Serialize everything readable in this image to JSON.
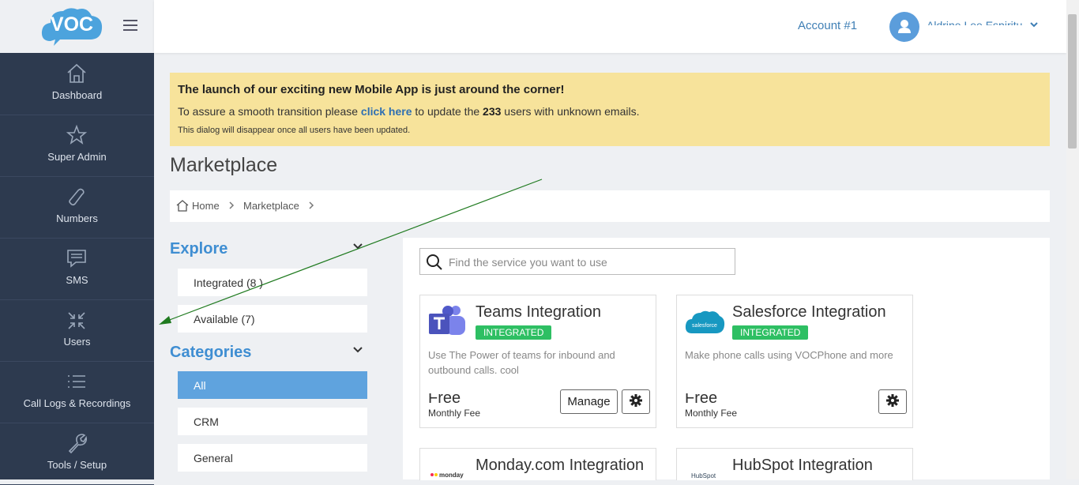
{
  "brand": {
    "logo_text": "VOC",
    "accent": "#3f8ed2"
  },
  "header": {
    "account_label": "Account #1",
    "user_name": "Aldrine Lee Espiritu"
  },
  "sidebar": {
    "items": [
      {
        "label": "Dashboard",
        "icon": "home-icon"
      },
      {
        "label": "Super Admin",
        "icon": "star-icon"
      },
      {
        "label": "Numbers",
        "icon": "phone-icon"
      },
      {
        "label": "SMS",
        "icon": "message-icon"
      },
      {
        "label": "Users",
        "icon": "compress-icon"
      },
      {
        "label": "Call Logs & Recordings",
        "icon": "list-icon"
      },
      {
        "label": "Tools / Setup",
        "icon": "wrench-icon"
      }
    ]
  },
  "banner": {
    "headline": "The launch of our exciting new Mobile App is just around the corner!",
    "line_prefix": "To assure a smooth transition please ",
    "link_text": "click here",
    "line_middle": " to update the ",
    "user_count": "233",
    "line_suffix": " users with unknown emails.",
    "note": "This dialog will disappear once all users have been updated."
  },
  "page": {
    "title": "Marketplace"
  },
  "breadcrumb": {
    "home": "Home",
    "current": "Marketplace"
  },
  "explore": {
    "heading": "Explore",
    "items": [
      {
        "label": "Integrated (8 )"
      },
      {
        "label": "Available (7)"
      }
    ]
  },
  "categories": {
    "heading": "Categories",
    "items": [
      {
        "label": "All",
        "active": true
      },
      {
        "label": "CRM"
      },
      {
        "label": "General"
      }
    ]
  },
  "search": {
    "placeholder": "Find the service you want to use"
  },
  "cards": [
    {
      "title": "Teams Integration",
      "badge": "INTEGRATED",
      "description": "Use The Power of teams for inbound and outbound calls. cool",
      "price": "Free",
      "fee_label": "Monthly Fee",
      "manage_label": "Manage"
    },
    {
      "title": "Salesforce Integration",
      "badge": "INTEGRATED",
      "logo_text": "salesforce",
      "description": "Make phone calls using VOCPhone and more",
      "price": "Free",
      "fee_label": "Monthly Fee"
    },
    {
      "title": "Monday.com Integration",
      "logo_text": "monday"
    },
    {
      "title": "HubSpot Integration",
      "logo_text": "HubSpot"
    }
  ]
}
